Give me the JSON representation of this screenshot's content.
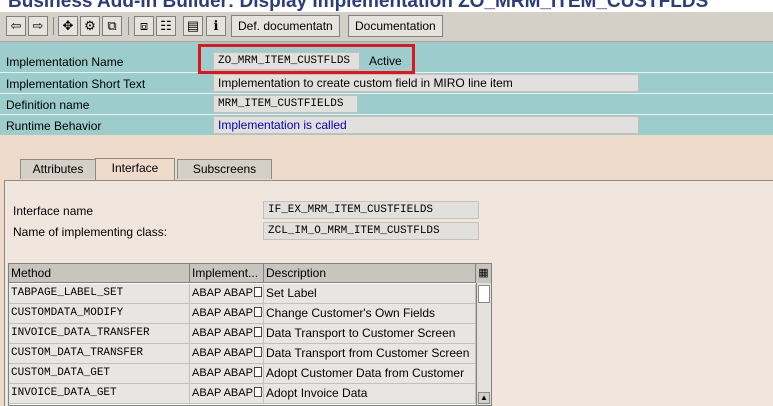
{
  "window": {
    "title": "Business Add-In Builder: Display Implementation ZO_MRM_ITEM_CUSTFLDS"
  },
  "toolbar": {
    "icons": [
      "back-icon",
      "forward-icon",
      "other-object-icon",
      "display-change-icon",
      "hierarchy-icon",
      "print-icon",
      "info-icon"
    ],
    "def_doc_label": "Def. documentatn",
    "doc_label": "Documentation"
  },
  "header": {
    "impl_name_label": "Implementation Name",
    "impl_name_value": "ZO_MRM_ITEM_CUSTFLDS",
    "impl_status": "Active",
    "short_text_label": "Implementation Short Text",
    "short_text_value": "Implementation to create custom field in MIRO line item",
    "def_name_label": "Definition name",
    "def_name_value": "MRM_ITEM_CUSTFIELDS",
    "runtime_label": "Runtime Behavior",
    "runtime_value": "Implementation is called"
  },
  "tabs": [
    {
      "label": "Attributes",
      "active": false
    },
    {
      "label": "Interface",
      "active": true
    },
    {
      "label": "Subscreens",
      "active": false
    }
  ],
  "interface": {
    "interface_name_label": "Interface name",
    "interface_name_value": "IF_EX_MRM_ITEM_CUSTFIELDS",
    "impl_class_label": "Name of implementing class:",
    "impl_class_value": "ZCL_IM_O_MRM_ITEM_CUSTFLDS"
  },
  "methods_table": {
    "columns": [
      "Method",
      "Implement...",
      "Description"
    ],
    "rows": [
      {
        "method": "TABPAGE_LABEL_SET",
        "impl": "ABAP ABAP",
        "desc": "Set Label"
      },
      {
        "method": "CUSTOMDATA_MODIFY",
        "impl": "ABAP ABAP",
        "desc": "Change Customer's Own Fields"
      },
      {
        "method": "INVOICE_DATA_TRANSFER",
        "impl": "ABAP ABAP",
        "desc": "Data Transport to Customer Screen"
      },
      {
        "method": "CUSTOM_DATA_TRANSFER",
        "impl": "ABAP ABAP",
        "desc": "Data Transport from Customer Screen"
      },
      {
        "method": "CUSTOM_DATA_GET",
        "impl": "ABAP ABAP",
        "desc": "Adopt Customer Data from Customer"
      },
      {
        "method": "INVOICE_DATA_GET",
        "impl": "ABAP ABAP",
        "desc": "Adopt Invoice Data"
      }
    ]
  },
  "colors": {
    "header_band": "#9ccccc",
    "background": "#efdbcc",
    "highlight": "#e3141c",
    "link_blue": "#0000cc"
  }
}
